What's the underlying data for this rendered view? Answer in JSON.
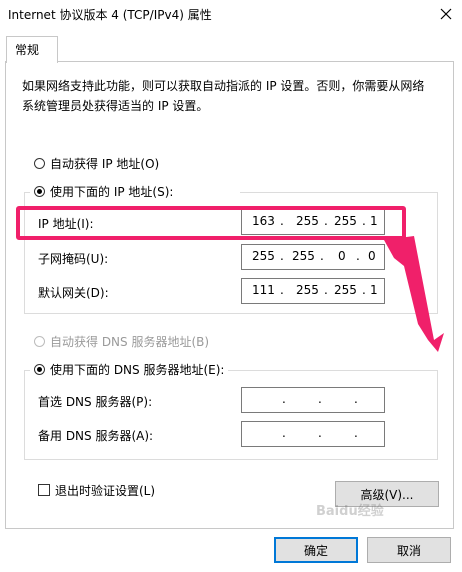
{
  "window": {
    "title": "Internet 协议版本 4 (TCP/IPv4) 属性"
  },
  "tabs": [
    {
      "label": "常规"
    }
  ],
  "description": "如果网络支持此功能，则可以获取自动指派的 IP 设置。否则，你需要从网络系统管理员处获得适当的 IP 设置。",
  "ip_section": {
    "auto_option": "自动获得 IP 地址(O)",
    "manual_option": "使用下面的 IP 地址(S):",
    "selected": "manual",
    "fields": [
      {
        "label": "IP 地址(I):",
        "octets": [
          "163",
          "255",
          "255",
          "1"
        ]
      },
      {
        "label": "子网掩码(U):",
        "octets": [
          "255",
          "255",
          "0",
          "0"
        ]
      },
      {
        "label": "默认网关(D):",
        "octets": [
          "111",
          "255",
          "255",
          "1"
        ]
      }
    ]
  },
  "dns_section": {
    "auto_option": "自动获得 DNS 服务器地址(B)",
    "manual_option": "使用下面的 DNS 服务器地址(E):",
    "selected": "manual",
    "fields": [
      {
        "label": "首选 DNS 服务器(P):",
        "octets": [
          "",
          "",
          "",
          ""
        ]
      },
      {
        "label": "备用 DNS 服务器(A):",
        "octets": [
          "",
          "",
          "",
          ""
        ]
      }
    ]
  },
  "validate_checkbox": {
    "label": "退出时验证设置(L)",
    "checked": false
  },
  "buttons": {
    "advanced": "高级(V)...",
    "ok": "确定",
    "cancel": "取消"
  },
  "watermark": "Baidu经验",
  "colors": {
    "highlight": "#f0206a",
    "accent": "#0078d7"
  }
}
